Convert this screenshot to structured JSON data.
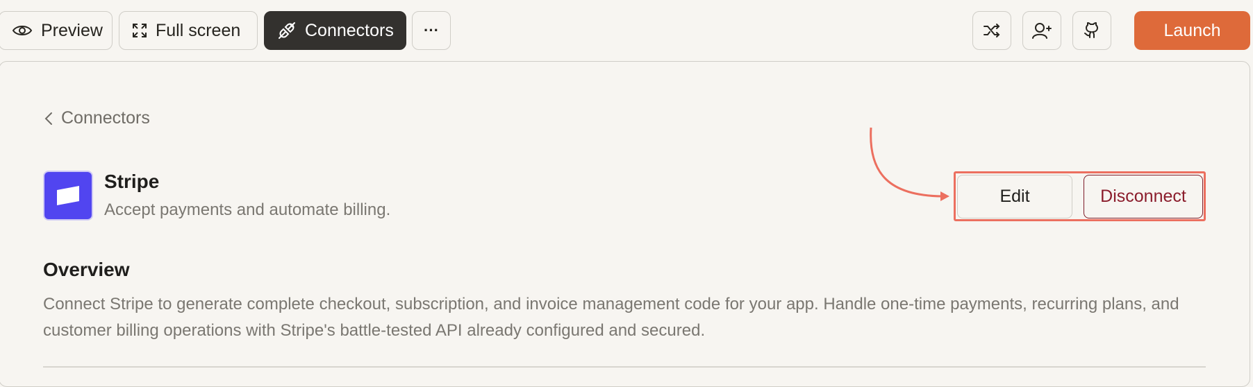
{
  "toolbar": {
    "preview_label": "Preview",
    "fullscreen_label": "Full screen",
    "connectors_label": "Connectors",
    "more_label": "···",
    "launch_label": "Launch",
    "icons": [
      "eye-icon",
      "expand-icon",
      "plug-icon",
      "shuffle-icon",
      "add-user-icon",
      "github-icon"
    ]
  },
  "nav": {
    "back_label": "Connectors"
  },
  "connector": {
    "name": "Stripe",
    "tagline": "Accept payments and automate billing.",
    "logo_icon": "stripe-logo",
    "brand_color": "#5145f0"
  },
  "actions": {
    "edit_label": "Edit",
    "disconnect_label": "Disconnect",
    "highlight_color": "#ec6f5f"
  },
  "overview": {
    "title": "Overview",
    "body": "Connect Stripe to generate complete checkout, subscription, and invoice management code for your app. Handle one-time payments, recurring plans, and customer billing operations with Stripe's battle-tested API already configured and secured."
  },
  "colors": {
    "accent": "#de6a3a",
    "disconnect": "#8b1d2c",
    "dark_button": "#33312e"
  }
}
